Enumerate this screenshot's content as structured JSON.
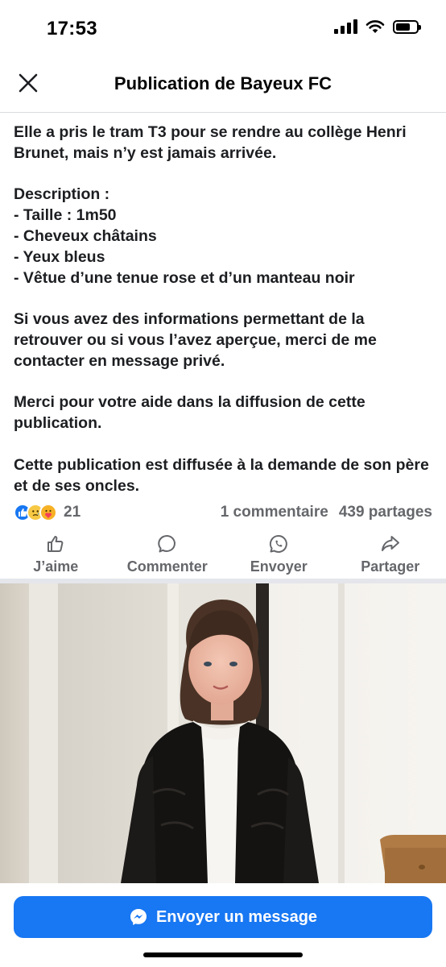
{
  "status_bar": {
    "time": "17:53"
  },
  "header": {
    "title": "Publication de Bayeux FC"
  },
  "post": {
    "text": "Elle a pris le tram T3 pour se rendre au collège Henri Brunet, mais n’y est jamais arrivée.\n\nDescription :\n- Taille : 1m50\n- Cheveux châtains\n- Yeux bleus\n- Vêtue d’une tenue rose et d’un manteau noir\n\nSi vous avez des informations permettant de la retrouver ou si vous l’avez aperçue, merci de me contacter en message privé.\n\nMerci pour votre aide dans la diffusion de cette publication.\n\nCette publication est diffusée à la demande de son père et de ses oncles."
  },
  "stats": {
    "reaction_icons": [
      "like-icon",
      "sad-icon",
      "care-icon"
    ],
    "reaction_count": "21",
    "comments": "1 commentaire",
    "shares": "439 partages"
  },
  "actions": {
    "like": "J’aime",
    "comment": "Commenter",
    "send": "Envoyer",
    "share": "Partager"
  },
  "cta": {
    "label": "Envoyer un message"
  },
  "colors": {
    "accent": "#1877f2",
    "muted_text": "#65676b",
    "divider": "#e4e6eb"
  }
}
